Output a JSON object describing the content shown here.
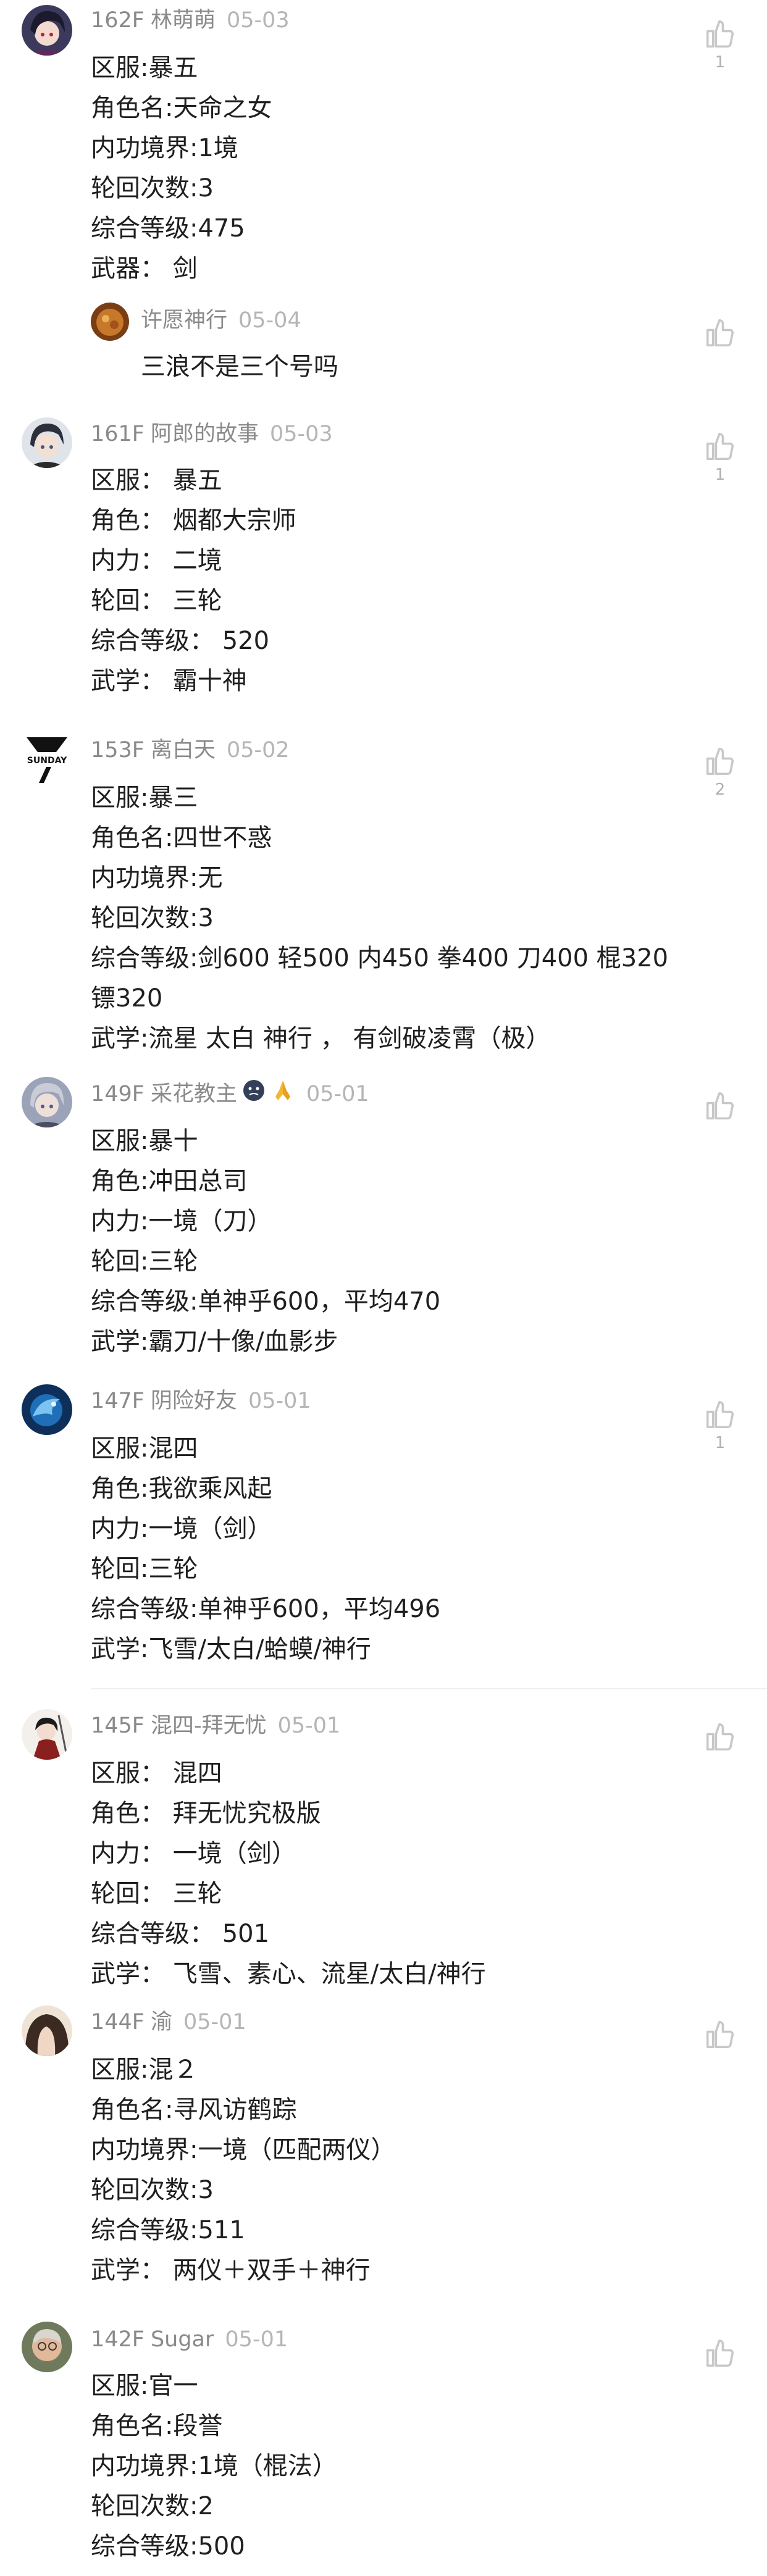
{
  "colors": {
    "text": "#1f1f1f",
    "meta": "#8a8a8a",
    "date": "#b5b5b5",
    "like_icon": "#c8c8c8",
    "divider": "#f0f0f0"
  },
  "posts": [
    {
      "floor": "162F",
      "user": "林萌萌",
      "date": "05-03",
      "avatar_icon": "anime-girl-avatar",
      "like_count": "1",
      "lines": [
        "区服:暴五",
        "角色名:天命之女",
        "内功境界:1境",
        "轮回次数:3",
        "综合等级:475",
        "武器： 剑"
      ],
      "reply": {
        "user": "许愿神行",
        "date": "05-04",
        "avatar_icon": "food-avatar",
        "text": "三浪不是三个号吗"
      }
    },
    {
      "floor": "161F",
      "user": "阿郎的故事",
      "date": "05-03",
      "avatar_icon": "anime-boy-avatar",
      "like_count": "1",
      "lines": [
        "区服： 暴五",
        "角色： 烟都大宗师",
        "内力： 二境",
        "轮回： 三轮",
        "综合等级： 520",
        "武学： 霸十神"
      ]
    },
    {
      "floor": "153F",
      "user": "离白天",
      "date": "05-02",
      "avatar_icon": "sunday-logo-avatar",
      "avatar_text": "SUNDAY",
      "like_count": "2",
      "lines": [
        "区服:暴三",
        "角色名:四世不惑",
        "内功境界:无",
        "轮回次数:3",
        "综合等级:剑600 轻500 内450 拳400 刀400 棍320 镖320",
        "武学:流星 太白 神行 ， 有剑破凌霄（极）"
      ]
    },
    {
      "floor": "149F",
      "user": "采花教主",
      "date": "05-01",
      "avatar_icon": "anime-portrait-avatar",
      "emoji": [
        "dark-face-emoji",
        "pray-hands-emoji"
      ],
      "like_count": "",
      "lines": [
        "区服:暴十",
        "角色:冲田总司",
        "内力:一境（刀）",
        "轮回:三轮",
        "综合等级:单神乎600，平均470",
        "武学:霸刀/十像/血影步"
      ]
    },
    {
      "floor": "147F",
      "user": "阴险好友",
      "date": "05-01",
      "avatar_icon": "blue-dragon-avatar",
      "like_count": "1",
      "lines": [
        "区服:混四",
        "角色:我欲乘风起",
        "内力:一境（剑）",
        "轮回:三轮",
        "综合等级:单神乎600，平均496",
        "武学:飞雪/太白/蛤蟆/神行"
      ]
    },
    {
      "floor": "145F",
      "user": "混四-拜无忧",
      "date": "05-01",
      "avatar_icon": "swordsman-avatar",
      "like_count": "",
      "lines": [
        "区服： 混四",
        "角色： 拜无忧究极版",
        "内力： 一境（剑）",
        "轮回： 三轮",
        "综合等级： 501",
        "武学： 飞雪、素心、流星/太白/神行"
      ]
    },
    {
      "floor": "144F",
      "user": "渝",
      "date": "05-01",
      "avatar_icon": "girl-hair-avatar",
      "like_count": "",
      "lines": [
        "区服:混２",
        "角色名:寻风访鹤踪",
        "内功境界:一境（匹配两仪）",
        "轮回次数:3",
        "综合等级:511",
        "武学： 两仪＋双手＋神行"
      ]
    },
    {
      "floor": "142F",
      "user": "Sugar",
      "date": "05-01",
      "avatar_icon": "old-man-avatar",
      "like_count": "",
      "lines": [
        "区服:官一",
        "角色名:段誉",
        "内功境界:1境（棍法）",
        "轮回次数:2",
        "综合等级:500"
      ]
    }
  ]
}
